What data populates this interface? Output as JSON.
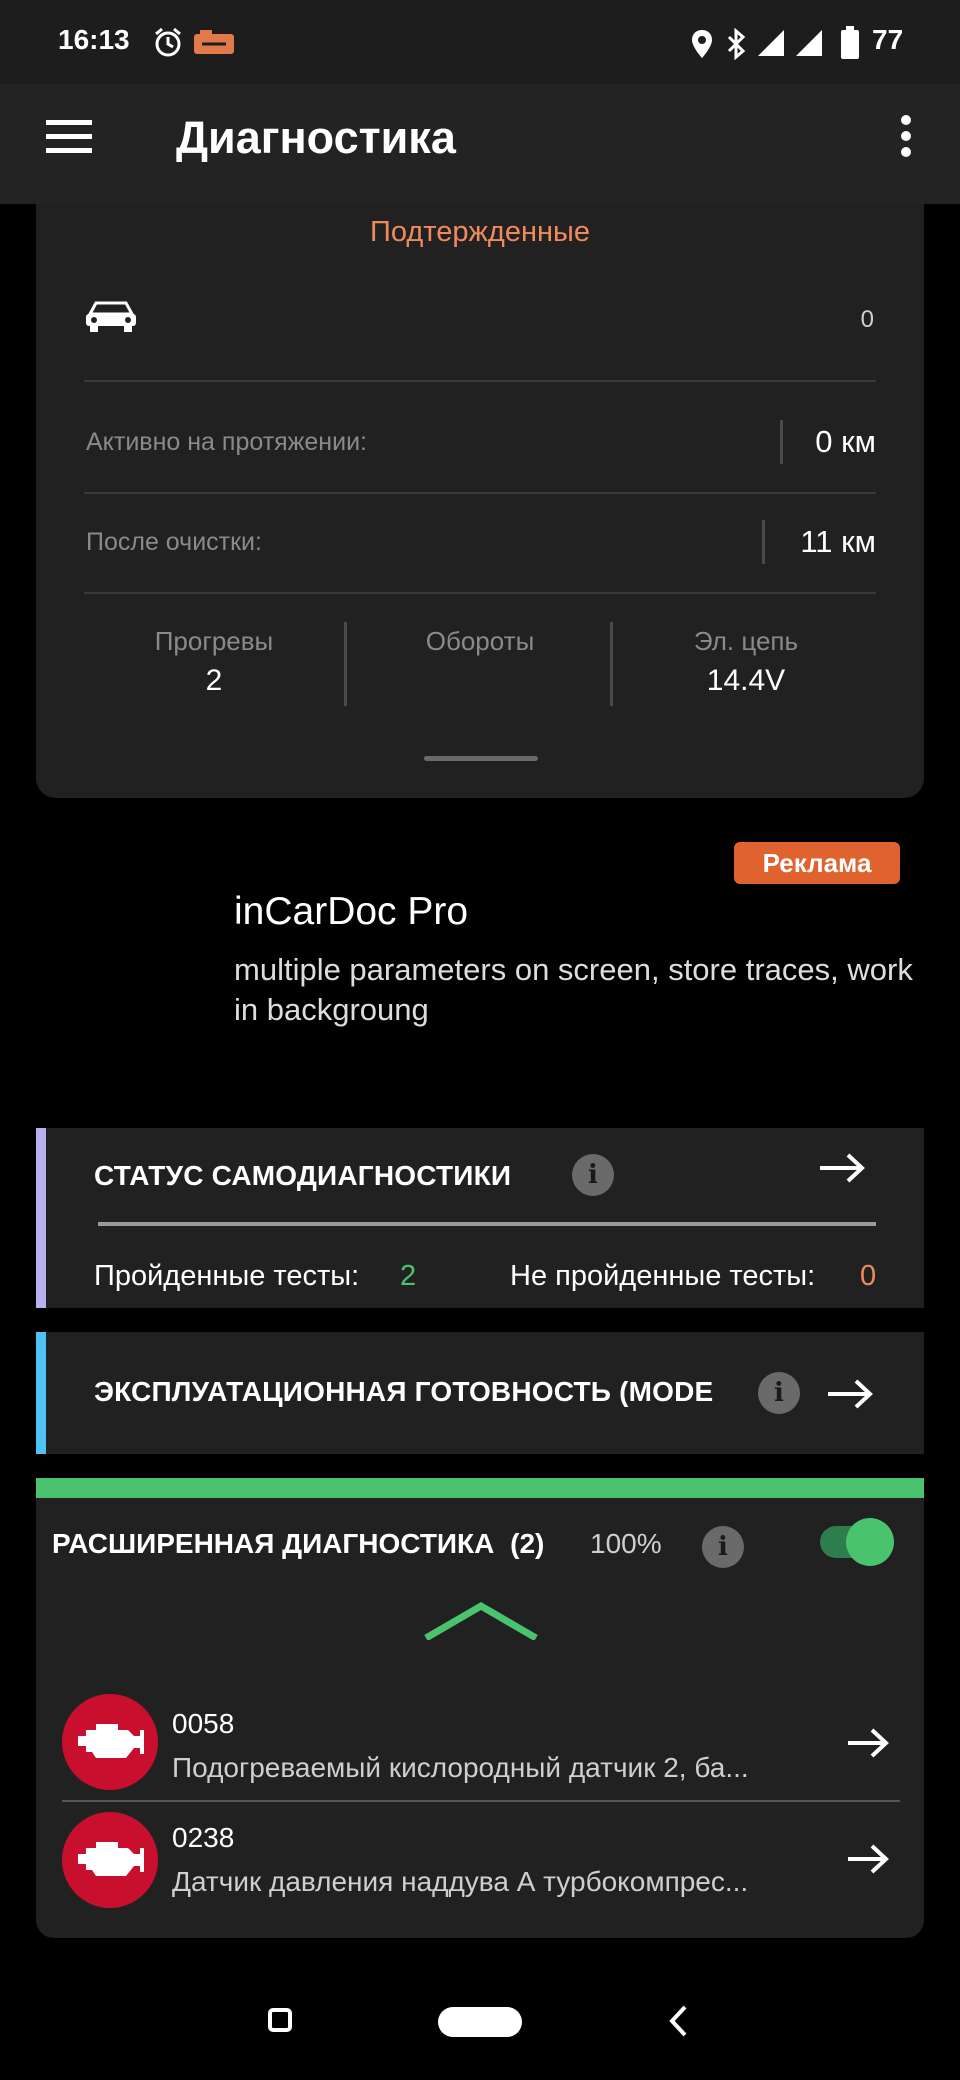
{
  "status_bar": {
    "time": "16:13",
    "battery": "77"
  },
  "app_bar": {
    "title": "Диагностика"
  },
  "confirmed": {
    "heading": "Подтержденные",
    "count": "0",
    "active_label": "Активно на протяжении:",
    "active_value": "0 км",
    "after_clear_label": "После очистки:",
    "after_clear_value": "11 км",
    "stats": [
      {
        "label": "Прогревы",
        "value": "2"
      },
      {
        "label": "Обороты",
        "value": ""
      },
      {
        "label": "Эл. цепь",
        "value": "14.4V"
      }
    ]
  },
  "ad": {
    "badge": "Реклама",
    "title": "inCarDoc Pro",
    "description": "multiple parameters on screen, store traces, work in backgroung"
  },
  "self_diag": {
    "title": "СТАТУС САМОДИАГНОСТИКИ",
    "passed_label": "Пройденные тесты:",
    "passed_value": "2",
    "failed_label": "Не пройденные тесты:",
    "failed_value": "0",
    "bar_color": "#b7b1f0"
  },
  "readiness": {
    "title": "ЭКСПЛУАТАЦИОННАЯ ГОТОВНОСТЬ (MODE",
    "bar_color": "#4fc3f7"
  },
  "extended": {
    "title": "РАСШИРЕННАЯ ДИАГНОСТИКА",
    "count": "(2)",
    "percent": "100%",
    "toggle_on": true,
    "accent": "#49c46d",
    "items": [
      {
        "code": "0058",
        "description": "Подогреваемый кислородный датчик 2, ба...",
        "icon": "engine-warning-icon"
      },
      {
        "code": "0238",
        "description": "Датчик давления наддува А турбокомпрес...",
        "icon": "engine-warning-icon"
      }
    ]
  },
  "colors": {
    "orange": "#f08a5d",
    "green": "#49c46d",
    "red_icon": "#c8102e",
    "ad_badge": "#e0622f"
  }
}
